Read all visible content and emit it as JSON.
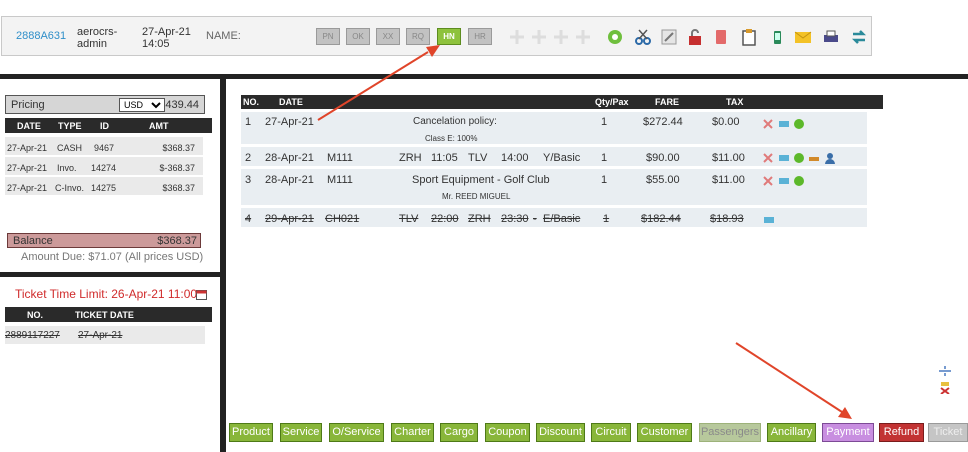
{
  "header": {
    "booking_ref": "2888A631",
    "user_line1": "aerocrs-",
    "user_line2": "admin",
    "date_line1": "27-Apr-21",
    "date_line2": "14:05",
    "name_label": "NAME:",
    "status_buttons": [
      "PN",
      "OK",
      "XX",
      "RQ",
      "HN",
      "HR"
    ],
    "active_status": "HN"
  },
  "pricing": {
    "label": "Pricing",
    "currency": "USD",
    "amount": "439.44",
    "columns": [
      "DATE",
      "TYPE",
      "ID",
      "AMT"
    ],
    "rows": [
      {
        "date": "27-Apr-21",
        "type": "CASH",
        "id": "9467",
        "amt": "$368.37"
      },
      {
        "date": "27-Apr-21",
        "type": "Invo.",
        "id": "14274",
        "amt": "$-368.37"
      },
      {
        "date": "27-Apr-21",
        "type": "C-Invo.",
        "id": "14275",
        "amt": "$368.37"
      }
    ],
    "balance_label": "Balance",
    "balance_value": "$368.37",
    "amount_due": "Amount Due: $71.07 (All prices USD)"
  },
  "ticket": {
    "time_limit": "Ticket Time Limit: 26-Apr-21 11:00",
    "columns": [
      "NO.",
      "TICKET DATE"
    ],
    "rows": [
      {
        "no": "2889117227",
        "date": "27-Apr-21"
      }
    ]
  },
  "main_table": {
    "columns": {
      "no": "NO.",
      "date": "DATE",
      "qty": "Qty/Pax",
      "fare": "FARE",
      "tax": "TAX"
    },
    "rows": [
      {
        "no": "1",
        "date": "27-Apr-21",
        "desc": "Cancelation policy:",
        "sub": "Class E: 100%",
        "qty": "1",
        "fare": "$272.44",
        "tax": "$0.00"
      },
      {
        "no": "2",
        "date": "28-Apr-21",
        "code": "M111",
        "from": "ZRH",
        "dep": "11:05",
        "to": "TLV",
        "arr": "14:00",
        "cls": "Y/Basic",
        "qty": "1",
        "fare": "$90.00",
        "tax": "$11.00"
      },
      {
        "no": "3",
        "date": "28-Apr-21",
        "code": "M111",
        "desc": "Sport Equipment - Golf Club",
        "sub": "Mr. REED MIGUEL",
        "qty": "1",
        "fare": "$55.00",
        "tax": "$11.00"
      },
      {
        "no": "4",
        "date": "29-Apr-21",
        "code": "CH021",
        "from": "TLV",
        "dep": "22:00",
        "to": "ZRH",
        "arr": "23:30",
        "dash": "-",
        "cls": "E/Basic",
        "qty": "1",
        "fare": "$182.44",
        "tax": "$18.93"
      }
    ]
  },
  "tabs": [
    "Product",
    "Service",
    "O/Service",
    "Charter",
    "Cargo",
    "Coupon",
    "Discount",
    "Circuit",
    "Customer",
    "Passengers",
    "Ancillary",
    "Payment",
    "Refund",
    "Ticket"
  ],
  "colors": {
    "accent_green": "#89b63a",
    "payment_purple": "#c88ee0",
    "refund_red": "#c23333",
    "arrow_red": "#e0452a"
  }
}
